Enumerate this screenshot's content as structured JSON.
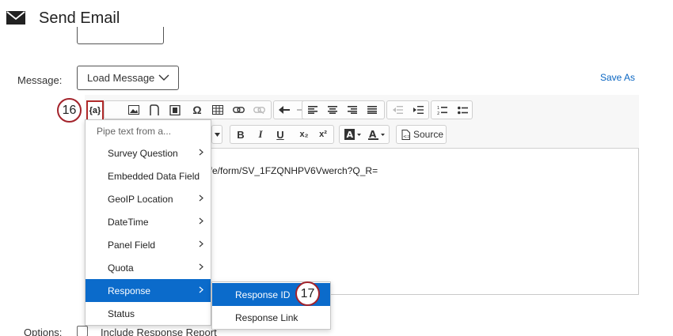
{
  "header": {
    "title": "Send Email",
    "icon": "envelope-icon"
  },
  "form": {
    "message_label": "Message:",
    "load_message": "Load Message",
    "save_as": "Save As",
    "options_label": "Options:",
    "include_report": "Include Response Report"
  },
  "editor": {
    "body_text": "ife/form/SV_1FZQNHPV6Vwerch?Q_R=",
    "toolbar": {
      "pipe_button": "{a}",
      "bold": "B",
      "italic": "I",
      "underline": "U",
      "subscript": "x₂",
      "superscript": "x²",
      "source": "Source"
    }
  },
  "pipe_menu": {
    "header": "Pipe text from a...",
    "items": [
      {
        "label": "Survey Question"
      },
      {
        "label": "Embedded Data Field"
      },
      {
        "label": "GeoIP Location"
      },
      {
        "label": "DateTime"
      },
      {
        "label": "Panel Field"
      },
      {
        "label": "Quota"
      },
      {
        "label": "Response"
      },
      {
        "label": "Status"
      }
    ],
    "active_item": "Response"
  },
  "response_submenu": {
    "items": [
      {
        "label": "Response ID"
      },
      {
        "label": "Response Link"
      }
    ],
    "active_item": "Response ID"
  },
  "markers": {
    "step_a": "16",
    "step_b": "17"
  },
  "colors": {
    "accent_blue": "#0b6bcb",
    "marker_red": "#a3232b",
    "link_blue": "#0a66c2"
  }
}
